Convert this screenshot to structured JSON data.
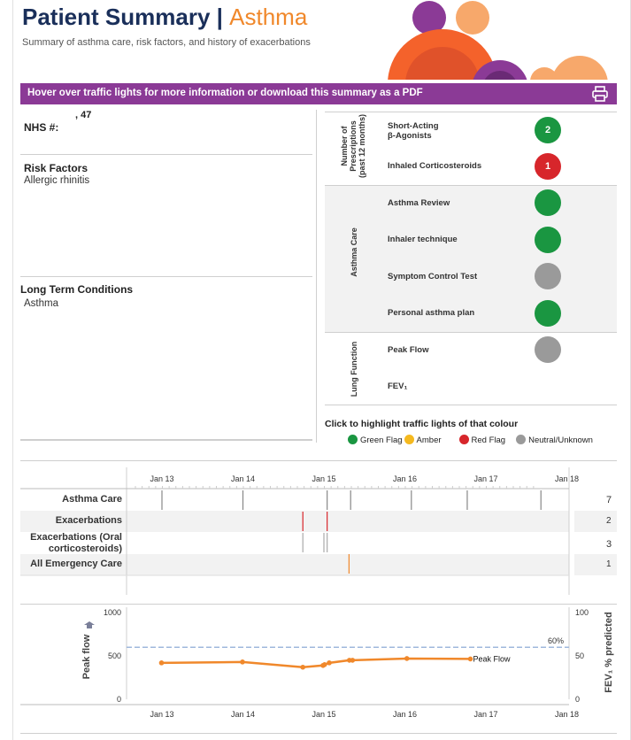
{
  "header": {
    "title": "Patient Summary | ",
    "title_condition": "Asthma",
    "subtitle": "Summary of asthma care, risk factors, and history of exacerbations"
  },
  "banner": {
    "text": "Hover over traffic lights for more information or download this summary as a PDF",
    "print_icon": "printer-icon"
  },
  "patient": {
    "nhs_label": "NHS #:",
    "nhs_value": ", 47",
    "risk_label": "Risk Factors",
    "risk_value": "Allergic rhinitis",
    "ltc_label": "Long Term Conditions",
    "ltc_value": "Asthma"
  },
  "traffic_lights": {
    "groups": [
      {
        "label": "Number of Prescriptions (past 12 months)",
        "line1": "Number of",
        "line2": "Prescriptions",
        "line3": "(past 12 months)"
      },
      {
        "label": "Asthma Care"
      },
      {
        "label": "Lung Function"
      }
    ],
    "rows": [
      {
        "label": "Short-Acting",
        "label2": "β-Agonists",
        "status": "green",
        "value": "2"
      },
      {
        "label": "Inhaled Corticosteroids",
        "status": "red",
        "value": "1"
      },
      {
        "label": "Asthma Review",
        "status": "green",
        "value": ""
      },
      {
        "label": "Inhaler technique",
        "status": "green",
        "value": ""
      },
      {
        "label": "Symptom Control Test",
        "status": "grey",
        "value": ""
      },
      {
        "label": "Personal asthma plan",
        "status": "green",
        "value": ""
      },
      {
        "label": "Peak Flow",
        "status": "grey",
        "value": ""
      },
      {
        "label": "FEV₁",
        "status": "none",
        "value": ""
      }
    ]
  },
  "legend": {
    "title": "Click to highlight traffic lights of that colour",
    "items": [
      {
        "label": "Green Flag",
        "color": "#1a9641"
      },
      {
        "label": "Amber",
        "color": "#f5b91f"
      },
      {
        "label": "Red Flag",
        "color": "#d7262b"
      },
      {
        "label": "Neutral/Unknown",
        "color": "#9a9a9a"
      }
    ]
  },
  "colors": {
    "green": "#1a9641",
    "red": "#d7262b",
    "grey": "#9a9a9a",
    "amber": "#f5b91f",
    "purple": "#8b3a96",
    "navy": "#1a2f5a",
    "orange": "#f0882b"
  },
  "timeline": {
    "ticks": [
      "Jan 13",
      "Jan 14",
      "Jan 15",
      "Jan 16",
      "Jan 17",
      "Jan 18"
    ],
    "rows": [
      {
        "label": "Asthma Care",
        "count": "7"
      },
      {
        "label": "Exacerbations",
        "count": "2"
      },
      {
        "label": "Exacerbations (Oral corticosteroids)",
        "label1": "Exacerbations (Oral",
        "label2": "corticosteroids)",
        "count": "3"
      },
      {
        "label": "All Emergency Care",
        "count": "1"
      }
    ],
    "events": [
      {
        "row": 0,
        "date": 2013.0,
        "color": "#888888"
      },
      {
        "row": 0,
        "date": 2014.0,
        "color": "#888888"
      },
      {
        "row": 0,
        "date": 2015.04,
        "color": "#888888"
      },
      {
        "row": 0,
        "date": 2015.33,
        "color": "#888888"
      },
      {
        "row": 0,
        "date": 2016.08,
        "color": "#888888"
      },
      {
        "row": 0,
        "date": 2016.77,
        "color": "#888888"
      },
      {
        "row": 0,
        "date": 2017.68,
        "color": "#888888"
      },
      {
        "row": 1,
        "date": 2014.74,
        "color": "#d7262b"
      },
      {
        "row": 1,
        "date": 2015.04,
        "color": "#d7262b"
      },
      {
        "row": 2,
        "date": 2014.74,
        "color": "#aaaaaa"
      },
      {
        "row": 2,
        "date": 2015.0,
        "color": "#aaaaaa"
      },
      {
        "row": 2,
        "date": 2015.04,
        "color": "#aaaaaa"
      },
      {
        "row": 3,
        "date": 2015.31,
        "color": "#f0882b"
      }
    ]
  },
  "chart_data": {
    "type": "line",
    "title": "",
    "xlabel": "",
    "ylabel": "Peak flow",
    "y2label": "FEV₁ % predicted",
    "x_ticks": [
      "Jan 13",
      "Jan 14",
      "Jan 15",
      "Jan 16",
      "Jan 17",
      "Jan 18"
    ],
    "ylim": [
      0,
      1000
    ],
    "y_ticks": [
      0,
      500,
      1000
    ],
    "y2lim": [
      0,
      100
    ],
    "y2_ticks": [
      0,
      50,
      100
    ],
    "reference_line": {
      "label": "60%",
      "y2": 60
    },
    "grid": false,
    "series": [
      {
        "name": "Peak Flow",
        "color": "#f0882b",
        "x": [
          "2012-12-30",
          "2013-12-30",
          "2014-09-28",
          "2014-12-28",
          "2015-01-04",
          "2015-01-25",
          "2015-04-26",
          "2015-05-10",
          "2016-01-10",
          "2016-10-23"
        ],
        "y": [
          420,
          430,
          370,
          390,
          400,
          420,
          450,
          450,
          470,
          465
        ]
      }
    ]
  }
}
